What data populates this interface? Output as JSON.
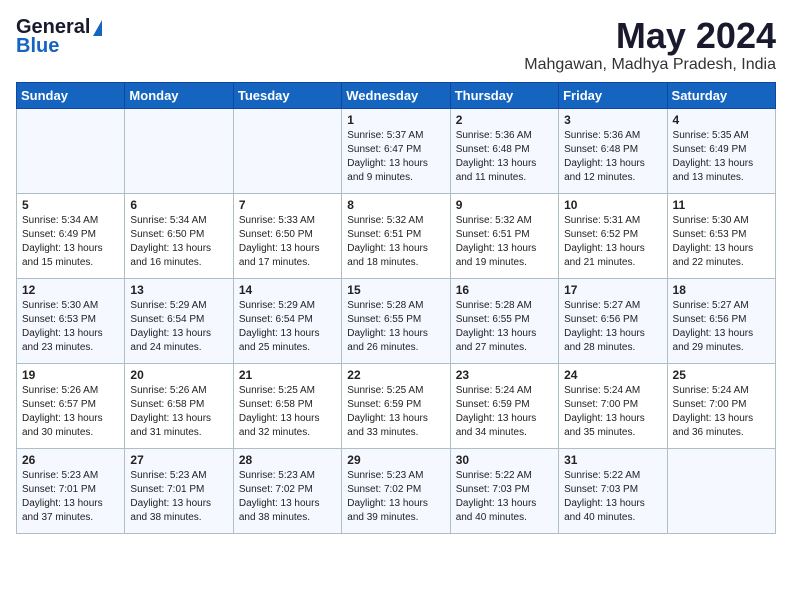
{
  "header": {
    "logo_general": "General",
    "logo_blue": "Blue",
    "title": "May 2024",
    "location": "Mahgawan, Madhya Pradesh, India"
  },
  "days_of_week": [
    "Sunday",
    "Monday",
    "Tuesday",
    "Wednesday",
    "Thursday",
    "Friday",
    "Saturday"
  ],
  "weeks": [
    [
      {
        "num": "",
        "info": ""
      },
      {
        "num": "",
        "info": ""
      },
      {
        "num": "",
        "info": ""
      },
      {
        "num": "1",
        "info": "Sunrise: 5:37 AM\nSunset: 6:47 PM\nDaylight: 13 hours\nand 9 minutes."
      },
      {
        "num": "2",
        "info": "Sunrise: 5:36 AM\nSunset: 6:48 PM\nDaylight: 13 hours\nand 11 minutes."
      },
      {
        "num": "3",
        "info": "Sunrise: 5:36 AM\nSunset: 6:48 PM\nDaylight: 13 hours\nand 12 minutes."
      },
      {
        "num": "4",
        "info": "Sunrise: 5:35 AM\nSunset: 6:49 PM\nDaylight: 13 hours\nand 13 minutes."
      }
    ],
    [
      {
        "num": "5",
        "info": "Sunrise: 5:34 AM\nSunset: 6:49 PM\nDaylight: 13 hours\nand 15 minutes."
      },
      {
        "num": "6",
        "info": "Sunrise: 5:34 AM\nSunset: 6:50 PM\nDaylight: 13 hours\nand 16 minutes."
      },
      {
        "num": "7",
        "info": "Sunrise: 5:33 AM\nSunset: 6:50 PM\nDaylight: 13 hours\nand 17 minutes."
      },
      {
        "num": "8",
        "info": "Sunrise: 5:32 AM\nSunset: 6:51 PM\nDaylight: 13 hours\nand 18 minutes."
      },
      {
        "num": "9",
        "info": "Sunrise: 5:32 AM\nSunset: 6:51 PM\nDaylight: 13 hours\nand 19 minutes."
      },
      {
        "num": "10",
        "info": "Sunrise: 5:31 AM\nSunset: 6:52 PM\nDaylight: 13 hours\nand 21 minutes."
      },
      {
        "num": "11",
        "info": "Sunrise: 5:30 AM\nSunset: 6:53 PM\nDaylight: 13 hours\nand 22 minutes."
      }
    ],
    [
      {
        "num": "12",
        "info": "Sunrise: 5:30 AM\nSunset: 6:53 PM\nDaylight: 13 hours\nand 23 minutes."
      },
      {
        "num": "13",
        "info": "Sunrise: 5:29 AM\nSunset: 6:54 PM\nDaylight: 13 hours\nand 24 minutes."
      },
      {
        "num": "14",
        "info": "Sunrise: 5:29 AM\nSunset: 6:54 PM\nDaylight: 13 hours\nand 25 minutes."
      },
      {
        "num": "15",
        "info": "Sunrise: 5:28 AM\nSunset: 6:55 PM\nDaylight: 13 hours\nand 26 minutes."
      },
      {
        "num": "16",
        "info": "Sunrise: 5:28 AM\nSunset: 6:55 PM\nDaylight: 13 hours\nand 27 minutes."
      },
      {
        "num": "17",
        "info": "Sunrise: 5:27 AM\nSunset: 6:56 PM\nDaylight: 13 hours\nand 28 minutes."
      },
      {
        "num": "18",
        "info": "Sunrise: 5:27 AM\nSunset: 6:56 PM\nDaylight: 13 hours\nand 29 minutes."
      }
    ],
    [
      {
        "num": "19",
        "info": "Sunrise: 5:26 AM\nSunset: 6:57 PM\nDaylight: 13 hours\nand 30 minutes."
      },
      {
        "num": "20",
        "info": "Sunrise: 5:26 AM\nSunset: 6:58 PM\nDaylight: 13 hours\nand 31 minutes."
      },
      {
        "num": "21",
        "info": "Sunrise: 5:25 AM\nSunset: 6:58 PM\nDaylight: 13 hours\nand 32 minutes."
      },
      {
        "num": "22",
        "info": "Sunrise: 5:25 AM\nSunset: 6:59 PM\nDaylight: 13 hours\nand 33 minutes."
      },
      {
        "num": "23",
        "info": "Sunrise: 5:24 AM\nSunset: 6:59 PM\nDaylight: 13 hours\nand 34 minutes."
      },
      {
        "num": "24",
        "info": "Sunrise: 5:24 AM\nSunset: 7:00 PM\nDaylight: 13 hours\nand 35 minutes."
      },
      {
        "num": "25",
        "info": "Sunrise: 5:24 AM\nSunset: 7:00 PM\nDaylight: 13 hours\nand 36 minutes."
      }
    ],
    [
      {
        "num": "26",
        "info": "Sunrise: 5:23 AM\nSunset: 7:01 PM\nDaylight: 13 hours\nand 37 minutes."
      },
      {
        "num": "27",
        "info": "Sunrise: 5:23 AM\nSunset: 7:01 PM\nDaylight: 13 hours\nand 38 minutes."
      },
      {
        "num": "28",
        "info": "Sunrise: 5:23 AM\nSunset: 7:02 PM\nDaylight: 13 hours\nand 38 minutes."
      },
      {
        "num": "29",
        "info": "Sunrise: 5:23 AM\nSunset: 7:02 PM\nDaylight: 13 hours\nand 39 minutes."
      },
      {
        "num": "30",
        "info": "Sunrise: 5:22 AM\nSunset: 7:03 PM\nDaylight: 13 hours\nand 40 minutes."
      },
      {
        "num": "31",
        "info": "Sunrise: 5:22 AM\nSunset: 7:03 PM\nDaylight: 13 hours\nand 40 minutes."
      },
      {
        "num": "",
        "info": ""
      }
    ]
  ]
}
